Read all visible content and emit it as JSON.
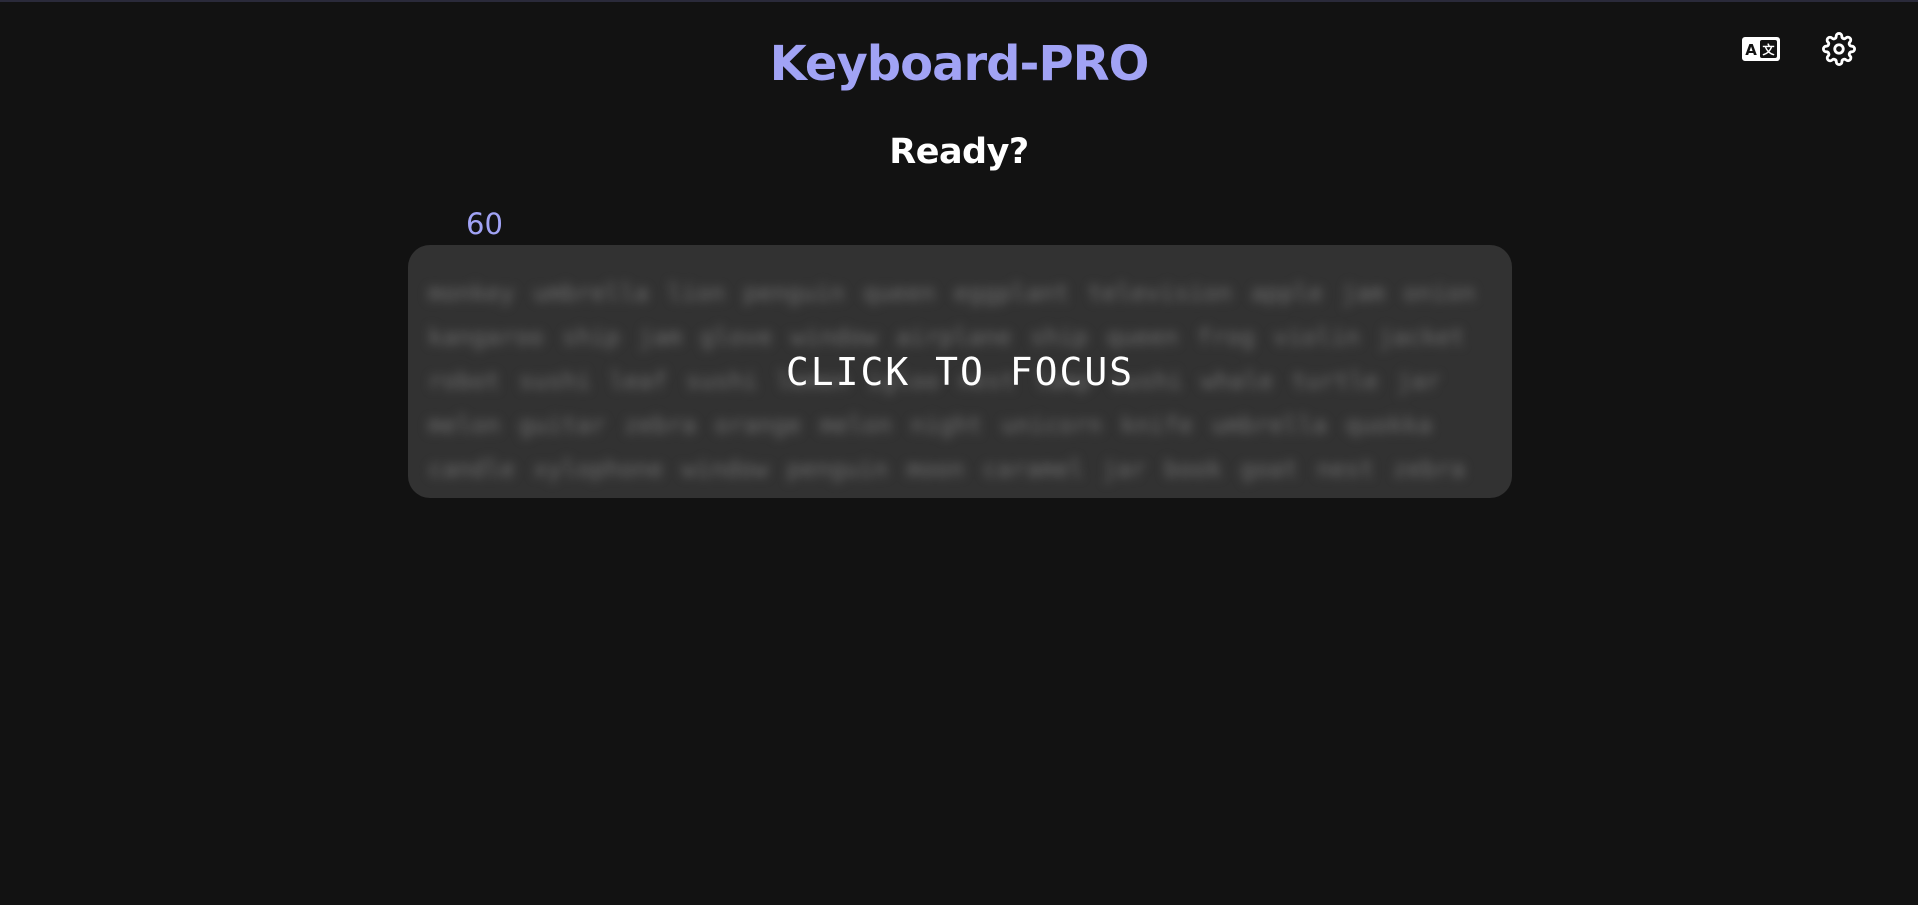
{
  "app": {
    "title": "Keyboard-PRO"
  },
  "header": {
    "language_icon": "translate-icon",
    "settings_icon": "gear-icon"
  },
  "status": {
    "text": "Ready?"
  },
  "timer": {
    "value": "60"
  },
  "typing_area": {
    "focus_prompt": "CLICK TO FOCUS",
    "words_text": "monkey umbrella lion penguin queen eggplant television apple jam onion kangaroo ship jam glove window airplane ship queen frog violin jacket robot sushi leaf sushi lemon igloo nest lamp sushi whale turtle jar melon guitar zebra orange melon night unicorn knife umbrella quokka candle xylophone window penguin moon caramel jar book goat nest zebra"
  },
  "colors": {
    "background": "#121212",
    "accent": "#a1a3f5",
    "box": "#323232",
    "text": "#ffffff"
  }
}
